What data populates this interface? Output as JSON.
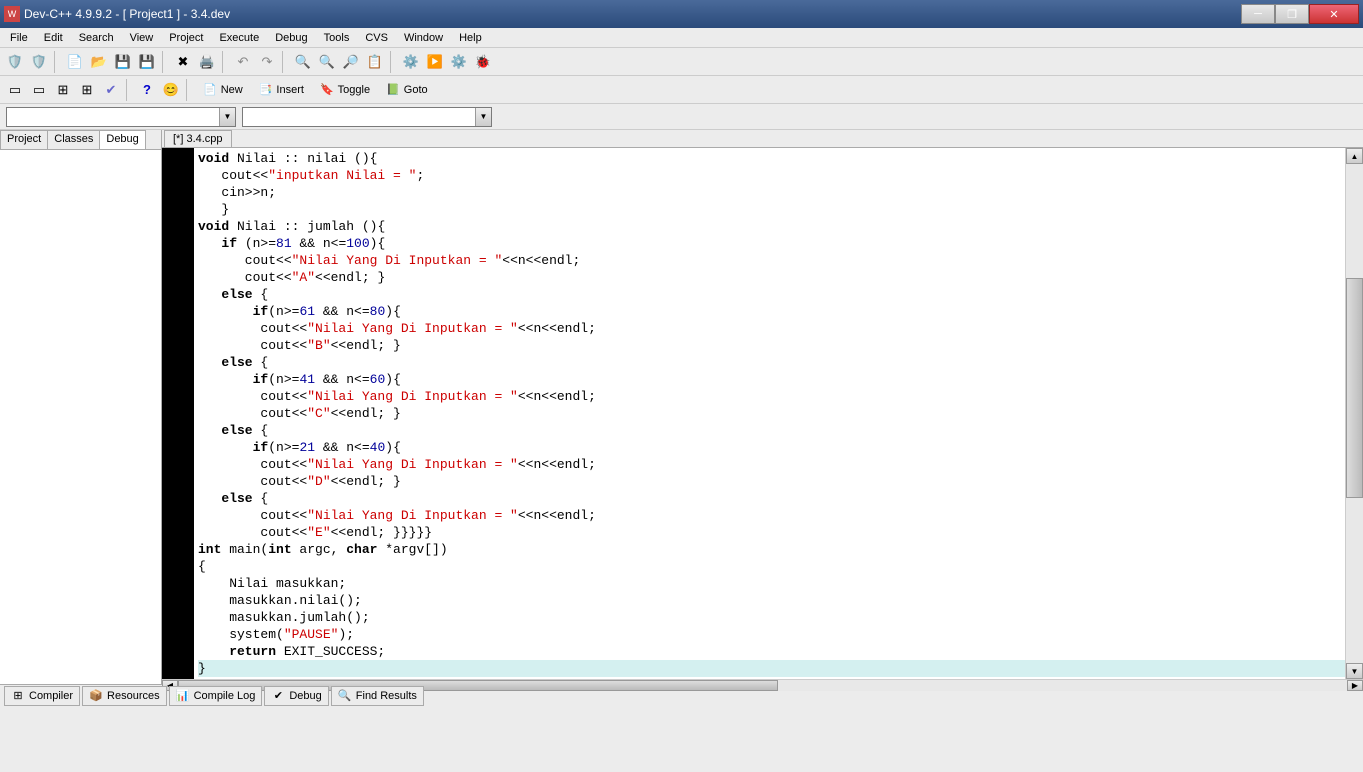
{
  "window": {
    "title": "Dev-C++ 4.9.9.2  -  [ Project1 ] - 3.4.dev",
    "icon_text": "W"
  },
  "menu": [
    "File",
    "Edit",
    "Search",
    "View",
    "Project",
    "Execute",
    "Debug",
    "Tools",
    "CVS",
    "Window",
    "Help"
  ],
  "toolbar2_labels": {
    "new": "New",
    "insert": "Insert",
    "toggle": "Toggle",
    "goto": "Goto"
  },
  "left_tabs": [
    "Project",
    "Classes",
    "Debug"
  ],
  "left_active_tab": 2,
  "file_tab": "[*] 3.4.cpp",
  "bottom_tabs": [
    "Compiler",
    "Resources",
    "Compile Log",
    "Debug",
    "Find Results"
  ],
  "code": {
    "lines": [
      {
        "indent": 0,
        "tokens": [
          {
            "t": "kw",
            "v": "void"
          },
          {
            "t": "p",
            "v": " Nilai :: nilai (){"
          }
        ]
      },
      {
        "indent": 1,
        "tokens": [
          {
            "t": "p",
            "v": "   cout<<"
          },
          {
            "t": "str",
            "v": "\"inputkan Nilai = \""
          },
          {
            "t": "p",
            "v": ";"
          }
        ]
      },
      {
        "indent": 1,
        "tokens": [
          {
            "t": "p",
            "v": "   cin>>n;"
          }
        ]
      },
      {
        "indent": 1,
        "tokens": [
          {
            "t": "p",
            "v": "   }"
          }
        ]
      },
      {
        "indent": 0,
        "tokens": [
          {
            "t": "kw",
            "v": "void"
          },
          {
            "t": "p",
            "v": " Nilai :: jumlah (){"
          }
        ]
      },
      {
        "indent": 1,
        "tokens": [
          {
            "t": "kw",
            "v": "   if"
          },
          {
            "t": "p",
            "v": " (n>="
          },
          {
            "t": "num",
            "v": "81"
          },
          {
            "t": "p",
            "v": " && n<="
          },
          {
            "t": "num",
            "v": "100"
          },
          {
            "t": "p",
            "v": "){"
          }
        ]
      },
      {
        "indent": 1,
        "tokens": [
          {
            "t": "p",
            "v": "      cout<<"
          },
          {
            "t": "str",
            "v": "\"Nilai Yang Di Inputkan = \""
          },
          {
            "t": "p",
            "v": "<<n<<endl;"
          }
        ]
      },
      {
        "indent": 1,
        "tokens": [
          {
            "t": "p",
            "v": "      cout<<"
          },
          {
            "t": "str",
            "v": "\"A\""
          },
          {
            "t": "p",
            "v": "<<endl; }"
          }
        ]
      },
      {
        "indent": 1,
        "tokens": [
          {
            "t": "kw",
            "v": "   else"
          },
          {
            "t": "p",
            "v": " {"
          }
        ]
      },
      {
        "indent": 1,
        "tokens": [
          {
            "t": "kw",
            "v": "       if"
          },
          {
            "t": "p",
            "v": "(n>="
          },
          {
            "t": "num",
            "v": "61"
          },
          {
            "t": "p",
            "v": " && n<="
          },
          {
            "t": "num",
            "v": "80"
          },
          {
            "t": "p",
            "v": "){"
          }
        ]
      },
      {
        "indent": 1,
        "tokens": [
          {
            "t": "p",
            "v": "        cout<<"
          },
          {
            "t": "str",
            "v": "\"Nilai Yang Di Inputkan = \""
          },
          {
            "t": "p",
            "v": "<<n<<endl;"
          }
        ]
      },
      {
        "indent": 1,
        "tokens": [
          {
            "t": "p",
            "v": "        cout<<"
          },
          {
            "t": "str",
            "v": "\"B\""
          },
          {
            "t": "p",
            "v": "<<endl; }"
          }
        ]
      },
      {
        "indent": 1,
        "tokens": [
          {
            "t": "kw",
            "v": "   else"
          },
          {
            "t": "p",
            "v": " {"
          }
        ]
      },
      {
        "indent": 1,
        "tokens": [
          {
            "t": "kw",
            "v": "       if"
          },
          {
            "t": "p",
            "v": "(n>="
          },
          {
            "t": "num",
            "v": "41"
          },
          {
            "t": "p",
            "v": " && n<="
          },
          {
            "t": "num",
            "v": "60"
          },
          {
            "t": "p",
            "v": "){"
          }
        ]
      },
      {
        "indent": 1,
        "tokens": [
          {
            "t": "p",
            "v": "        cout<<"
          },
          {
            "t": "str",
            "v": "\"Nilai Yang Di Inputkan = \""
          },
          {
            "t": "p",
            "v": "<<n<<endl;"
          }
        ]
      },
      {
        "indent": 1,
        "tokens": [
          {
            "t": "p",
            "v": "        cout<<"
          },
          {
            "t": "str",
            "v": "\"C\""
          },
          {
            "t": "p",
            "v": "<<endl; }"
          }
        ]
      },
      {
        "indent": 1,
        "tokens": [
          {
            "t": "kw",
            "v": "   else"
          },
          {
            "t": "p",
            "v": " {"
          }
        ]
      },
      {
        "indent": 1,
        "tokens": [
          {
            "t": "kw",
            "v": "       if"
          },
          {
            "t": "p",
            "v": "(n>="
          },
          {
            "t": "num",
            "v": "21"
          },
          {
            "t": "p",
            "v": " && n<="
          },
          {
            "t": "num",
            "v": "40"
          },
          {
            "t": "p",
            "v": "){"
          }
        ]
      },
      {
        "indent": 1,
        "tokens": [
          {
            "t": "p",
            "v": "        cout<<"
          },
          {
            "t": "str",
            "v": "\"Nilai Yang Di Inputkan = \""
          },
          {
            "t": "p",
            "v": "<<n<<endl;"
          }
        ]
      },
      {
        "indent": 1,
        "tokens": [
          {
            "t": "p",
            "v": "        cout<<"
          },
          {
            "t": "str",
            "v": "\"D\""
          },
          {
            "t": "p",
            "v": "<<endl; }"
          }
        ]
      },
      {
        "indent": 1,
        "tokens": [
          {
            "t": "kw",
            "v": "   else"
          },
          {
            "t": "p",
            "v": " {"
          }
        ]
      },
      {
        "indent": 1,
        "tokens": [
          {
            "t": "p",
            "v": "        cout<<"
          },
          {
            "t": "str",
            "v": "\"Nilai Yang Di Inputkan = \""
          },
          {
            "t": "p",
            "v": "<<n<<endl;"
          }
        ]
      },
      {
        "indent": 1,
        "tokens": [
          {
            "t": "p",
            "v": "        cout<<"
          },
          {
            "t": "str",
            "v": "\"E\""
          },
          {
            "t": "p",
            "v": "<<endl; }}}}}"
          }
        ]
      },
      {
        "indent": 0,
        "tokens": [
          {
            "t": "kw",
            "v": "int"
          },
          {
            "t": "p",
            "v": " main("
          },
          {
            "t": "kw",
            "v": "int"
          },
          {
            "t": "p",
            "v": " argc, "
          },
          {
            "t": "kw",
            "v": "char"
          },
          {
            "t": "p",
            "v": " *argv[])"
          }
        ]
      },
      {
        "indent": 0,
        "tokens": [
          {
            "t": "p",
            "v": "{"
          }
        ]
      },
      {
        "indent": 0,
        "tokens": [
          {
            "t": "p",
            "v": "    Nilai masukkan;"
          }
        ]
      },
      {
        "indent": 0,
        "tokens": [
          {
            "t": "p",
            "v": "    masukkan.nilai();"
          }
        ]
      },
      {
        "indent": 0,
        "tokens": [
          {
            "t": "p",
            "v": "    masukkan.jumlah();"
          }
        ]
      },
      {
        "indent": 0,
        "tokens": [
          {
            "t": "p",
            "v": "    system("
          },
          {
            "t": "str",
            "v": "\"PAUSE\""
          },
          {
            "t": "p",
            "v": ");"
          }
        ]
      },
      {
        "indent": 0,
        "tokens": [
          {
            "t": "kw",
            "v": "    return"
          },
          {
            "t": "p",
            "v": " EXIT_SUCCESS;"
          }
        ]
      },
      {
        "indent": 0,
        "hl": true,
        "tokens": [
          {
            "t": "p",
            "v": "}"
          }
        ]
      }
    ]
  }
}
